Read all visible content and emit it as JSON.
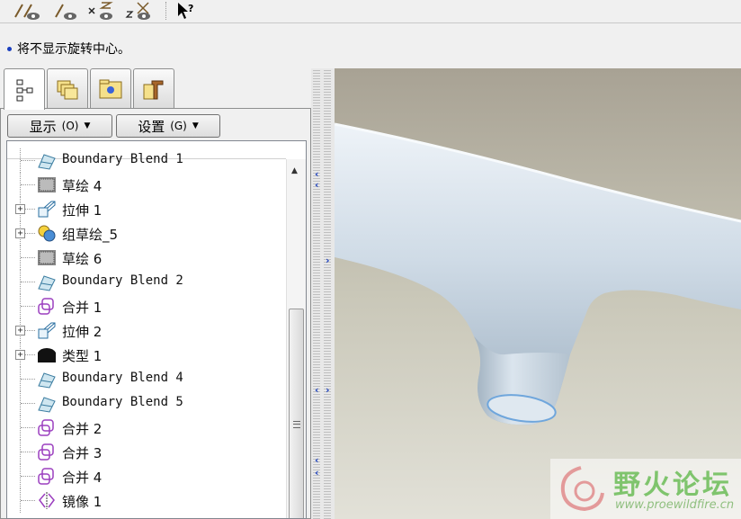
{
  "toolbar": {
    "buttons": [
      "sketch-show-icon",
      "sketch-hide-icon",
      "hide-x-icon",
      "unhide-z-icon",
      "whats-this-icon"
    ]
  },
  "message": {
    "text": "将不显示旋转中心。"
  },
  "tabs": [
    {
      "name": "model-tree-icon",
      "active": true
    },
    {
      "name": "folder-browser-icon",
      "active": false
    },
    {
      "name": "favorites-icon",
      "active": false
    },
    {
      "name": "connections-icon",
      "active": false
    }
  ],
  "tree_controls": {
    "show_label": "显示",
    "show_shortcut": "(O)",
    "settings_label": "设置",
    "settings_shortcut": "(G)"
  },
  "tree": {
    "items": [
      {
        "label": "Boundary Blend 1",
        "icon": "boundary-blend-icon",
        "expandable": false
      },
      {
        "label": "草绘 4",
        "icon": "sketch-icon",
        "expandable": false
      },
      {
        "label": "拉伸 1",
        "icon": "extrude-icon",
        "expandable": true
      },
      {
        "label": "组草绘_5",
        "icon": "group-icon",
        "expandable": true
      },
      {
        "label": "草绘 6",
        "icon": "sketch-icon",
        "expandable": false
      },
      {
        "label": "Boundary Blend 2",
        "icon": "boundary-blend-icon",
        "expandable": false
      },
      {
        "label": "合并 1",
        "icon": "merge-icon",
        "expandable": false
      },
      {
        "label": "拉伸 2",
        "icon": "extrude-icon",
        "expandable": true
      },
      {
        "label": "类型 1",
        "icon": "style-icon",
        "expandable": true
      },
      {
        "label": "Boundary Blend 4",
        "icon": "boundary-blend-icon",
        "expandable": false
      },
      {
        "label": "Boundary Blend 5",
        "icon": "boundary-blend-icon",
        "expandable": false
      },
      {
        "label": "合并 2",
        "icon": "merge-icon",
        "expandable": false
      },
      {
        "label": "合并 3",
        "icon": "merge-icon",
        "expandable": false
      },
      {
        "label": "合并 4",
        "icon": "merge-icon",
        "expandable": false
      },
      {
        "label": "镜像 1",
        "icon": "mirror-icon",
        "expandable": false
      }
    ]
  },
  "watermark": {
    "title": "野火论坛",
    "url": "www.proewildfire.cn"
  },
  "colors": {
    "accent": "#1a3fbf",
    "viewport_background": "#c9c7b7",
    "model": "#cfdce8",
    "watermark": "#7fc46d"
  }
}
